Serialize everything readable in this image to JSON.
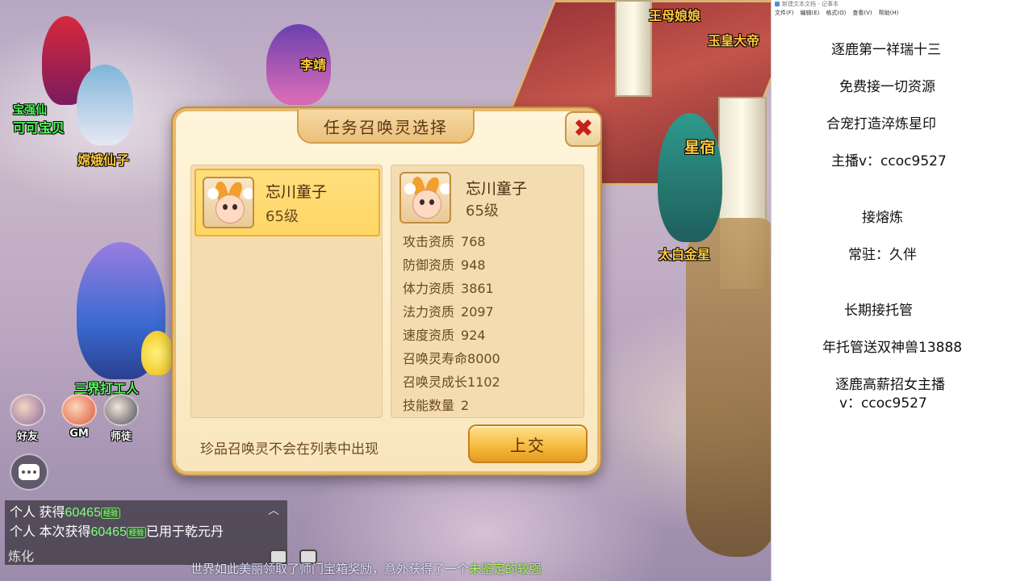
{
  "game": {
    "npc_labels": {
      "wangmu": "王母娘娘",
      "yuhuang": "玉皇大帝",
      "xingxiu": "星宿",
      "taibai": "太白金星",
      "change": "嫦娥仙子",
      "baobao": "宝强仙",
      "keke": "可可宝贝",
      "lizhi": "李靖",
      "player_bottom": "三界打工人"
    },
    "social": {
      "friends": "好友",
      "gm": "GM",
      "mentor": "师徒"
    },
    "chat": {
      "lines": [
        {
          "channel": "个人",
          "text": "获得",
          "amount": "60465",
          "tag": "经验",
          "suffix": ""
        },
        {
          "channel": "个人",
          "text": "本次获得",
          "amount": "60465",
          "tag": "经验",
          "suffix": "已用于乾元丹"
        }
      ],
      "footer": "炼化"
    },
    "broadcast": {
      "text": "世界如此美丽领取了师门宝箱奖励，意外获得了一个",
      "highlight": "未鉴定的较强"
    }
  },
  "dialog": {
    "title": "任务召唤灵选择",
    "close_symbol": "✖",
    "list": [
      {
        "name": "忘川童子",
        "level": "65级"
      }
    ],
    "detail": {
      "name": "忘川童子",
      "level": "65级",
      "stats": [
        {
          "key": "攻击资质",
          "value": "768"
        },
        {
          "key": "防御资质",
          "value": "948"
        },
        {
          "key": "体力资质",
          "value": "3861"
        },
        {
          "key": "法力资质",
          "value": "2097"
        },
        {
          "key": "速度资质",
          "value": "924"
        },
        {
          "key": "召唤灵寿命",
          "value": "8000"
        },
        {
          "key": "召唤灵成长",
          "value": "1102"
        },
        {
          "key": "技能数量",
          "value": "2"
        }
      ]
    },
    "note": "珍品召唤灵不会在列表中出现",
    "submit_label": "上交"
  },
  "notepad": {
    "title": "新建文本文档 - 记事本",
    "menu": [
      "文件(F)",
      "编辑(E)",
      "格式(O)",
      "查看(V)",
      "帮助(H)"
    ],
    "lines": [
      "逐鹿第一祥瑞十三",
      "免费接一切资源",
      "合宠打造淬炼星印",
      "主播v：ccoc9527",
      "接熔炼",
      "常驻：久伴",
      "长期接托管",
      "年托管送双神兽13888",
      "逐鹿高薪招女主播",
      "v：ccoc9527"
    ]
  }
}
